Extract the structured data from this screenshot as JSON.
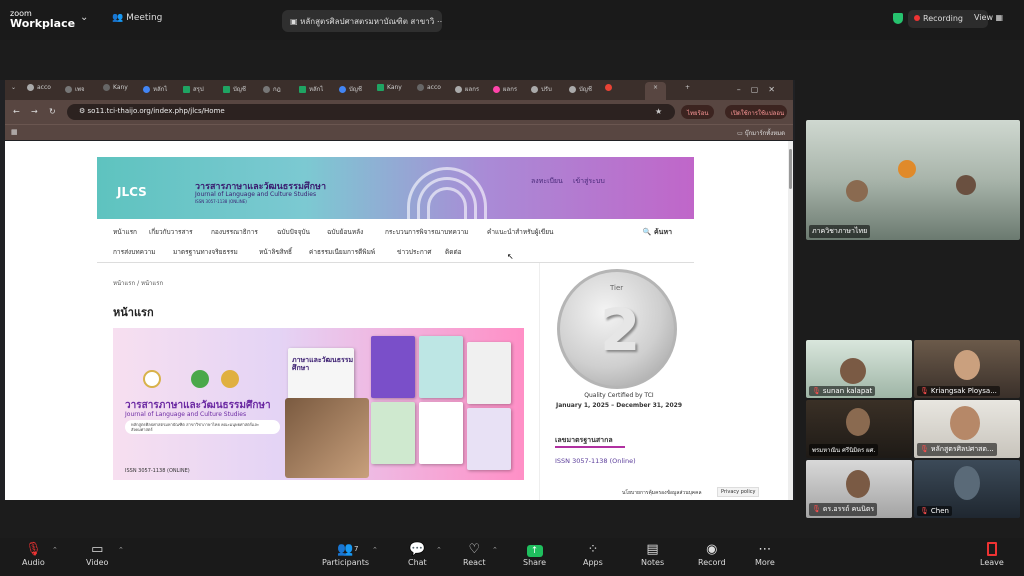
{
  "zoom": {
    "product_line1": "zoom",
    "product_line2": "Workplace",
    "meeting_tab": "Meeting",
    "shared_window": "หลักสูตรศิลปศาสตรมหาบัณฑิต สาขาวิ",
    "recording": "Recording",
    "view": "View"
  },
  "browser": {
    "tabs": [
      "acco",
      "เพจ",
      "Kany",
      "หลักไ",
      "สรุป",
      "บัญชี",
      "กฎ",
      "หลักไ",
      "บัญชี",
      "Kany",
      "acco",
      "ผลกร",
      "ผลกร",
      "ปรับ",
      "บัญชี"
    ],
    "url": "so11.tci-thaijo.org/index.php/jlcs/Home",
    "ext1": "ไทยร้อน",
    "ext2": "เปิดใช้การใช้แปลอน",
    "bookmarks_folder": "บุ๊กมาร์กทั้งหมด"
  },
  "site": {
    "logo": "JLCS",
    "title_th": "วารสารภาษาและวัฒนธรรมศึกษา",
    "title_en": "Journal of Language and Culture Studies",
    "issn_small": "ISSN 3057-1138 (ONLINE)",
    "register": "ลงทะเบียน",
    "login": "เข้าสู่ระบบ",
    "nav_row1": [
      "หน้าแรก",
      "เกี่ยวกับวารสาร",
      "กองบรรณาธิการ",
      "ฉบับปัจจุบัน",
      "ฉบับย้อนหลัง",
      "กระบวนการพิจารณาบทความ",
      "คำแนะนำสำหรับผู้เขียน"
    ],
    "nav_row2": [
      "การส่งบทความ",
      "มาตรฐานทางจริยธรรม",
      "หน้าลิขสิทธิ์",
      "ค่าธรรมเนียมการตีพิมพ์",
      "ข่าวประกาศ",
      "ติดต่อ"
    ],
    "search": "ค้นหา",
    "breadcrumb": [
      "หน้าแรก",
      "หน้าแรก"
    ],
    "page_heading": "หน้าแรก",
    "hero": {
      "title_th": "วารสารภาษาและวัฒนธรรมศึกษา",
      "title_en": "Journal of Language and Culture Studies",
      "note": "หลักสูตรศิลปศาสตรมหาบัณฑิต สาขาวิชาภาษาไทย คณะมนุษยศาสตร์และสังคมศาสตร์",
      "issn": "ISSN 3057-1138 (ONLINE)",
      "book_label": "ภาษาและวัฒนธรรมศึกษา"
    },
    "badge": {
      "tier_word": "Tier",
      "tier": "2",
      "caption": "Quality Certified by TCI",
      "period": "January 1, 2025 – December 31, 2029"
    },
    "sidebar_heading": "เลขมาตรฐานสากล",
    "sidebar_issn": "ISSN 3057-1138 (Online)",
    "privacy_th": "นโยบายการคุ้มครองข้อมูลส่วนบุคคล",
    "privacy_btn": "Privacy policy"
  },
  "participants": [
    {
      "name": "ภาควิชาภาษาไทย"
    },
    {
      "name": "sunan kalapat"
    },
    {
      "name": "Kriangsak Ploysa..."
    },
    {
      "name": "พรมหาณิน ศรีนิมิตร ผศ."
    },
    {
      "name": "หลักสูตรศิลปศาสต..."
    },
    {
      "name": "ดร.อรรถ์ คนนิตร"
    },
    {
      "name": "Chen"
    }
  ],
  "toolbar": {
    "audio": "Audio",
    "video": "Video",
    "participants": "Participants",
    "participant_count": "7",
    "chat": "Chat",
    "react": "React",
    "share": "Share",
    "apps": "Apps",
    "notes": "Notes",
    "record": "Record",
    "more": "More",
    "leave": "Leave"
  }
}
